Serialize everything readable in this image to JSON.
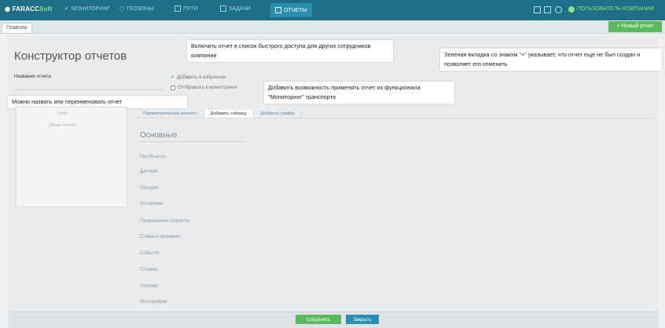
{
  "brand": {
    "name": "FARACC",
    "suffix": "Soft"
  },
  "nav": [
    {
      "label": "МОНИТОРИНГ"
    },
    {
      "label": "ГЕОЗОНЫ"
    },
    {
      "label": "ПУТИ"
    },
    {
      "label": "ЗАДАЧИ"
    },
    {
      "label": "ОТЧЕТЫ"
    }
  ],
  "user": {
    "name": "ПОЛЬЗОВАТЕЛЬ КОМПАНИИ"
  },
  "tabs": {
    "main": "Главная",
    "new_report": "+ Новый отчет"
  },
  "page": {
    "title": "Конструктор отчетов",
    "name_label": "Название отчета",
    "checkbox_favorites": "Добавить в избранное",
    "checkbox_monitoring": "Отображать в мониторинге"
  },
  "callouts": {
    "favorites": "Включить отчет в список быстрого доступа для других сотрудников компании",
    "monitoring": "Добавить возможность применять отчет из функционала \"Мониторинг\" транспорта",
    "new_tab": "Зеленая вкладка со знаком \"+\" указывает, что отчет еще не был создан и позволяет его отменить",
    "rename": "Можно назвать или переименовать отчет"
  },
  "left_panel": {
    "line1": "Отчет",
    "line2": "Объект отчета"
  },
  "subtabs": [
    "Параметрический элемент",
    "Добавить таблицу",
    "Добавить график"
  ],
  "section": {
    "title": "Основные",
    "items": [
      "Геообъекты",
      "Датчики",
      "Поездки",
      "Остановки",
      "Превышения скорости",
      "Сливы и заправки",
      "События",
      "Стоянки",
      "Топливо",
      "Фотографии"
    ]
  },
  "footer": {
    "save": "Сохранить",
    "cancel": "Закрыть"
  },
  "colors": {
    "topbar": "#1f6f86",
    "accent_green": "#5cb85c",
    "accent_blue": "#2b8fb0"
  }
}
